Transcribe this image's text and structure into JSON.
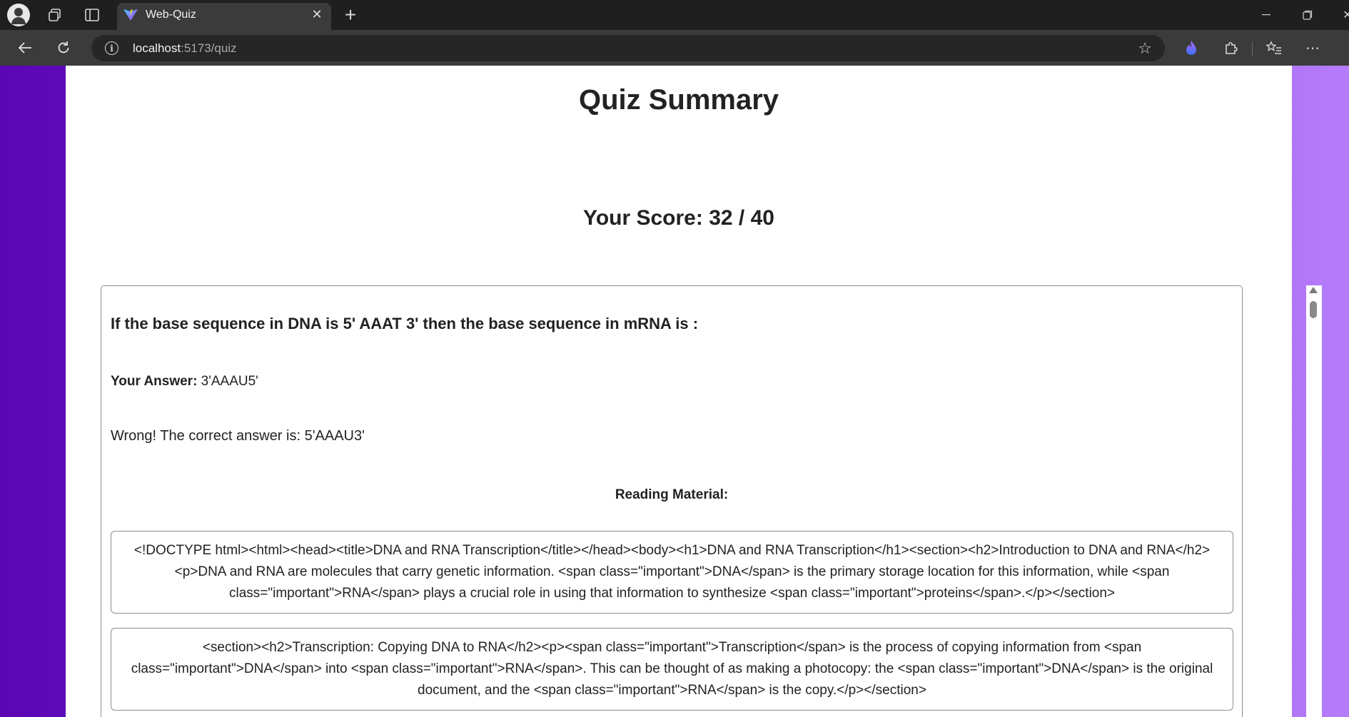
{
  "browser": {
    "tab_title": "Web-Quiz",
    "tab_close_icon": "close-icon",
    "new_tab_icon": "plus-icon",
    "url_host": "localhost",
    "url_path": ":5173/quiz",
    "window_controls": [
      "minimize-icon",
      "restore-icon",
      "close-icon"
    ],
    "toolbar_icons": [
      "back-icon",
      "refresh-icon",
      "info-icon",
      "favorite-star-icon",
      "copilot-flame-icon",
      "extensions-puzzle-icon",
      "favorites-icon",
      "more-icon"
    ]
  },
  "page": {
    "title": "Quiz Summary",
    "score": "Your Score: 32 / 40",
    "colors": {
      "gradient_start": "#5b05b5",
      "gradient_end": "#b57cfa",
      "card": "#ffffff"
    }
  },
  "result": {
    "question": "If the base sequence in DNA is 5' AAAT 3' then the base sequence in mRNA is :",
    "your_answer_label": "Your Answer:",
    "your_answer_value": " 3'AAAU5'",
    "feedback": "Wrong! The correct answer is: 5'AAAU3'",
    "reading_heading": "Reading Material:",
    "materials": [
      "<!DOCTYPE html><html><head><title>DNA and RNA Transcription</title></head><body><h1>DNA and RNA Transcription</h1><section><h2>Introduction to DNA and RNA</h2><p>DNA and RNA are molecules that carry genetic information. <span class=\"important\">DNA</span> is the primary storage location for this information, while <span class=\"important\">RNA</span> plays a crucial role in using that information to synthesize <span class=\"important\">proteins</span>.</p></section>",
      "<section><h2>Transcription: Copying DNA to RNA</h2><p><span class=\"important\">Transcription</span> is the process of copying information from <span class=\"important\">DNA</span> into <span class=\"important\">RNA</span>. This can be thought of as making a photocopy: the <span class=\"important\">DNA</span> is the original document, and the <span class=\"important\">RNA</span> is the copy.</p></section>"
    ]
  }
}
